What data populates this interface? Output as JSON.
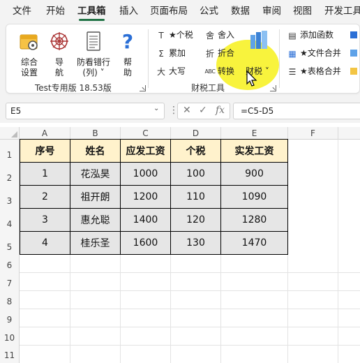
{
  "menu": {
    "tabs": [
      "文件",
      "开始",
      "工具箱",
      "插入",
      "页面布局",
      "公式",
      "数据",
      "审阅",
      "视图",
      "开发工具"
    ],
    "active": "工具箱"
  },
  "ribbon": {
    "test_group": {
      "buttons": [
        {
          "line1": "综合",
          "line2": "设置"
        },
        {
          "line1": "导",
          "line2": "航"
        },
        {
          "line1": "防看错行",
          "line2": "(列) ˅"
        },
        {
          "line1": "帮",
          "line2": "助"
        }
      ],
      "label": "Test专用版 18.53版"
    },
    "tax_group": {
      "items": [
        {
          "icon": "T",
          "label": "★个税"
        },
        {
          "icon": "Σ",
          "label": "累加"
        },
        {
          "icon": "大",
          "label": "大写"
        },
        {
          "icon": "舍",
          "label": "舍入"
        },
        {
          "icon": "折",
          "label": "折合"
        },
        {
          "icon": "ABC",
          "label": "转换"
        }
      ],
      "dropdown": "财税 ˅",
      "label": "财税工具"
    },
    "right_group": {
      "items": [
        "添加函数",
        "★文件合并",
        "★表格合并"
      ]
    }
  },
  "formula_bar": {
    "name_box": "E5",
    "formula": "=C5-D5"
  },
  "grid": {
    "columns": [
      "A",
      "B",
      "C",
      "D",
      "E",
      "F"
    ],
    "rows": [
      "1",
      "2",
      "3",
      "4",
      "5",
      "6",
      "7",
      "8",
      "9",
      "10",
      "11"
    ],
    "headers": [
      "序号",
      "姓名",
      "应发工资",
      "个税",
      "实发工资"
    ],
    "data": [
      [
        "1",
        "花泓昊",
        "1000",
        "100",
        "900"
      ],
      [
        "2",
        "祖开朗",
        "1200",
        "110",
        "1090"
      ],
      [
        "3",
        "惠允聪",
        "1400",
        "120",
        "1280"
      ],
      [
        "4",
        "桂乐圣",
        "1600",
        "130",
        "1470"
      ]
    ]
  },
  "colors": {
    "accent": "#217346",
    "header_fill": "#fff2cc",
    "body_fill": "#e6e6e6",
    "highlight": "#f7f22c"
  }
}
